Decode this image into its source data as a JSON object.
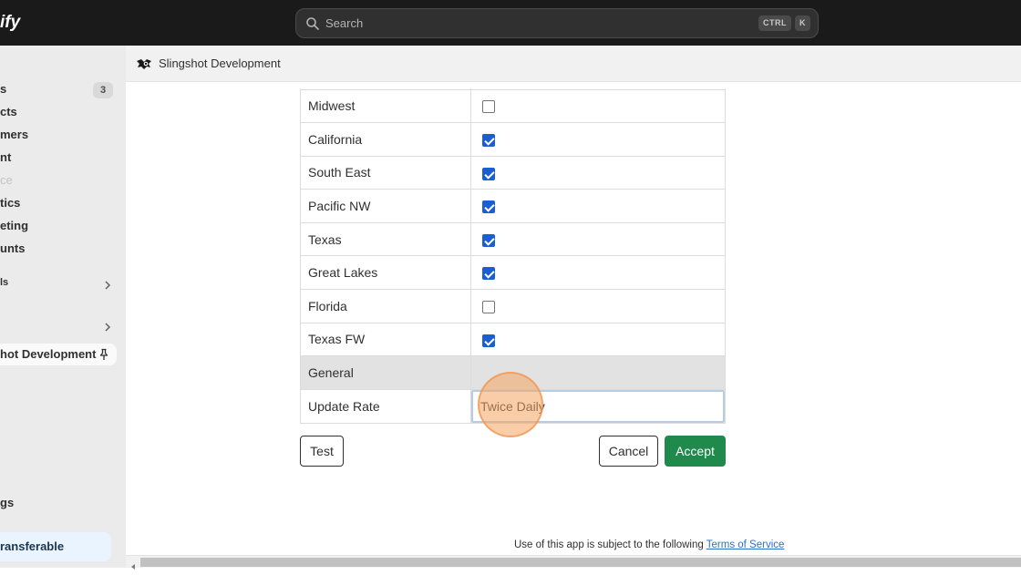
{
  "topbar": {
    "logo": "ify",
    "search_placeholder": "Search",
    "shortcut_key1": "CTRL",
    "shortcut_key2": "K"
  },
  "sidebar": {
    "items": [
      {
        "label": "s",
        "badge": "3"
      },
      {
        "label": "cts"
      },
      {
        "label": "mers"
      },
      {
        "label": "nt"
      },
      {
        "label": "ce"
      },
      {
        "label": "tics"
      },
      {
        "label": "eting"
      },
      {
        "label": "unts"
      },
      {
        "label": "ls"
      },
      {
        "label": ""
      }
    ],
    "pinned_app": "hot Development",
    "settings": "gs",
    "nontransferable": "ransferable"
  },
  "app_header": {
    "title": "Slingshot Development"
  },
  "regions": [
    {
      "label": "Midwest",
      "checked": false
    },
    {
      "label": "California",
      "checked": true
    },
    {
      "label": "South East",
      "checked": true
    },
    {
      "label": "Pacific NW",
      "checked": true
    },
    {
      "label": "Texas",
      "checked": true
    },
    {
      "label": "Great Lakes",
      "checked": true
    },
    {
      "label": "Florida",
      "checked": false
    },
    {
      "label": "Texas FW",
      "checked": true
    }
  ],
  "general": {
    "section_label": "General",
    "update_rate_label": "Update Rate",
    "update_rate_value": "Twice Daily"
  },
  "buttons": {
    "test": "Test",
    "cancel": "Cancel",
    "accept": "Accept"
  },
  "footer": {
    "text": "Use of this app is subject to the following",
    "link": "Terms of Service"
  },
  "colors": {
    "accept_bg": "#1f8a4c",
    "checkbox_checked": "#1a5fd1",
    "topbar_bg": "#1a1a1a"
  }
}
